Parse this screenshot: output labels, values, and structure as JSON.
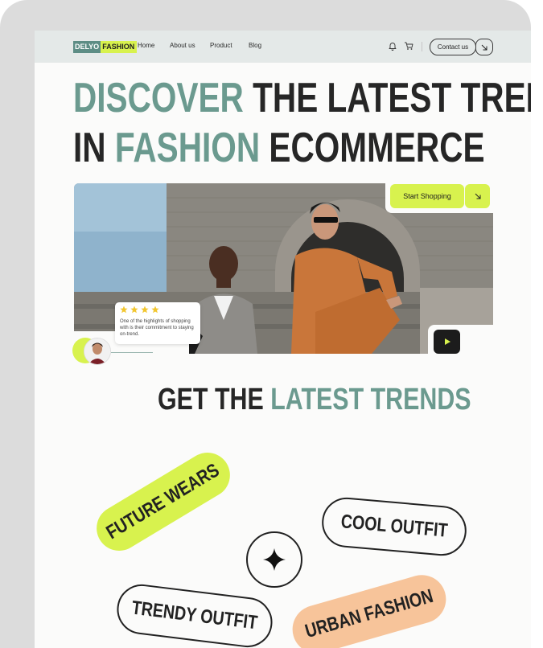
{
  "brand": {
    "part1": "DELYO",
    "part2": "FASHION"
  },
  "nav": {
    "links": [
      "Home",
      "About us",
      "Product",
      "Blog"
    ],
    "contact_label": "Contact us"
  },
  "hero": {
    "line1_accent": "DISCOVER",
    "line1_rest": " THE LATEST TRENDS",
    "line2_start": "IN ",
    "line2_accent": "FASHION",
    "line2_rest": " ECOMMERCE",
    "cta_label": "Start Shopping"
  },
  "review": {
    "rating": 4,
    "text": "One of the highlights of shopping with is their commitment to staying on-trend."
  },
  "section": {
    "title_start": "GET THE ",
    "title_accent": "LATEST TRENDS"
  },
  "tags": {
    "future": "FUTURE WEARS",
    "cool": "COOL OUTFIT",
    "trendy": "TRENDY OUTFIT",
    "urban": "URBAN FASHION"
  },
  "colors": {
    "accent": "#6b9a8f",
    "lime": "#d8f24e",
    "peach": "#f7c49a",
    "dark": "#262626"
  },
  "icons": [
    "bell-icon",
    "cart-icon",
    "arrow-down-right-icon",
    "play-icon",
    "star-icon",
    "sparkle-icon"
  ]
}
